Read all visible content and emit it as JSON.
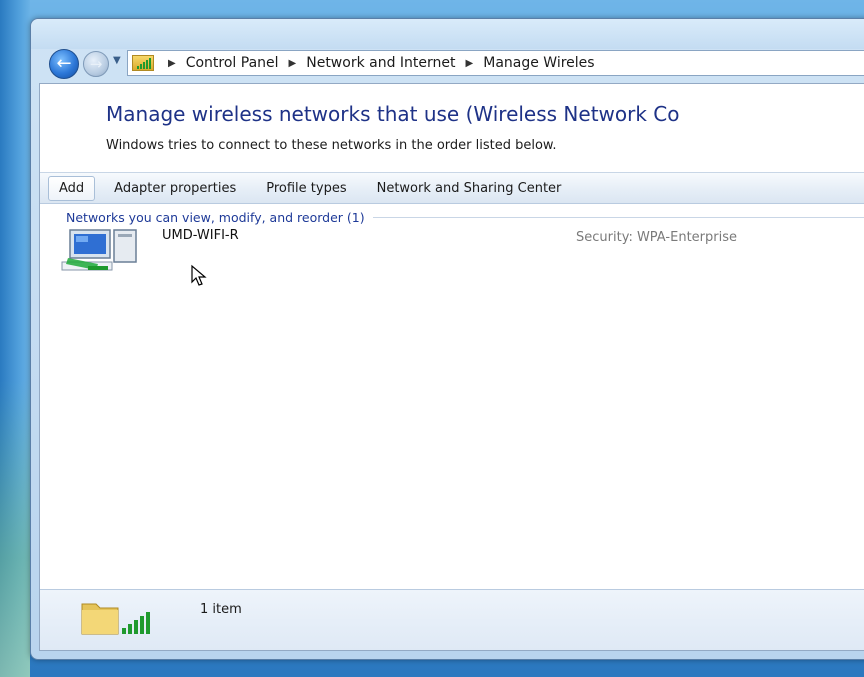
{
  "window": {
    "breadcrumb": [
      {
        "label": "Control Panel"
      },
      {
        "label": "Network and Internet"
      },
      {
        "label": "Manage Wireles"
      }
    ]
  },
  "page": {
    "heading": "Manage wireless networks that use (Wireless Network Co",
    "subheading": "Windows tries to connect to these networks in the order listed below."
  },
  "toolbar": {
    "items": [
      {
        "label": "Add"
      },
      {
        "label": "Adapter properties"
      },
      {
        "label": "Profile types"
      },
      {
        "label": "Network and Sharing Center"
      }
    ]
  },
  "group": {
    "label": "Networks you can view, modify, and reorder (1)"
  },
  "networks": [
    {
      "name": "UMD-WIFI-R",
      "security": "Security:  WPA-Enterprise"
    }
  ],
  "status": {
    "count": "1 item"
  },
  "icons": {
    "back": "back-arrow-icon",
    "forward": "forward-arrow-icon",
    "address": "wireless-network-folder-icon",
    "network": "wireless-computer-icon",
    "status": "wireless-folder-icon"
  }
}
